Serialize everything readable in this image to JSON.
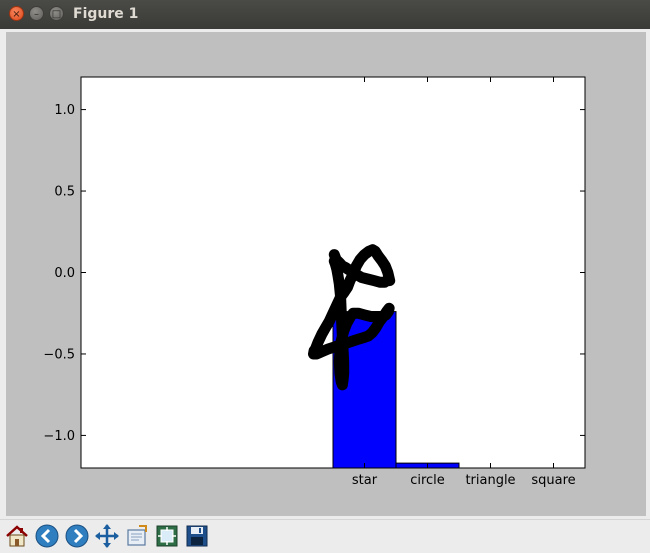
{
  "window": {
    "title": "Figure 1"
  },
  "titlebar_buttons": {
    "close_icon": "×",
    "minimize_icon": "–",
    "maximize_icon": "□"
  },
  "toolbar": {
    "items": [
      {
        "icon": "home-icon"
      },
      {
        "icon": "back-arrow-icon"
      },
      {
        "icon": "forward-arrow-icon"
      },
      {
        "icon": "pan-arrows-icon"
      },
      {
        "icon": "zoom-rect-icon"
      },
      {
        "icon": "subplots-config-icon"
      },
      {
        "icon": "save-floppy-icon"
      }
    ]
  },
  "chart_data": {
    "type": "bar",
    "categories": [
      "star",
      "circle",
      "triangle",
      "square"
    ],
    "values": [
      -0.24,
      -1.17,
      -1.2,
      -1.2
    ],
    "bar_color": "#0000ff",
    "bottom": -1.2,
    "ylim": [
      -1.2,
      1.2
    ],
    "yticks": [
      1.0,
      0.5,
      0.0,
      -0.5,
      -1.0
    ],
    "ytick_labels": [
      "1.0",
      "0.5",
      "0.0",
      "−0.5",
      "−1.0"
    ],
    "grid": false,
    "overlay_stroke": {
      "color": "#000000",
      "points": [
        [
          0.02,
          0.11
        ],
        [
          0.05,
          0.08
        ],
        [
          0.1,
          0.06
        ],
        [
          0.15,
          0.04
        ],
        [
          0.2,
          0.03
        ],
        [
          0.28,
          0.01
        ],
        [
          0.36,
          -0.01
        ],
        [
          0.45,
          -0.03
        ],
        [
          0.55,
          -0.04
        ],
        [
          0.65,
          -0.05
        ],
        [
          0.75,
          -0.06
        ],
        [
          0.82,
          -0.06
        ],
        [
          0.85,
          -0.05
        ],
        [
          0.88,
          -0.04
        ],
        [
          0.9,
          -0.05
        ],
        [
          0.87,
          0.0
        ],
        [
          0.83,
          0.04
        ],
        [
          0.78,
          0.07
        ],
        [
          0.72,
          0.1
        ],
        [
          0.67,
          0.13
        ],
        [
          0.63,
          0.14
        ],
        [
          0.57,
          0.13
        ],
        [
          0.5,
          0.11
        ],
        [
          0.43,
          0.08
        ],
        [
          0.37,
          0.04
        ],
        [
          0.32,
          -0.01
        ],
        [
          0.27,
          -0.05
        ],
        [
          0.23,
          -0.09
        ],
        [
          0.18,
          -0.12
        ],
        [
          0.12,
          -0.15
        ],
        [
          0.06,
          -0.2
        ],
        [
          0.0,
          -0.25
        ],
        [
          -0.06,
          -0.3
        ],
        [
          -0.12,
          -0.34
        ],
        [
          -0.18,
          -0.38
        ],
        [
          -0.24,
          -0.43
        ],
        [
          -0.28,
          -0.47
        ],
        [
          -0.3,
          -0.48
        ],
        [
          -0.31,
          -0.5
        ],
        [
          -0.26,
          -0.5
        ],
        [
          -0.2,
          -0.49
        ],
        [
          -0.14,
          -0.48
        ],
        [
          -0.08,
          -0.47
        ],
        [
          0.0,
          -0.46
        ],
        [
          0.08,
          -0.45
        ],
        [
          0.16,
          -0.44
        ],
        [
          0.24,
          -0.43
        ],
        [
          0.32,
          -0.42
        ],
        [
          0.4,
          -0.41
        ],
        [
          0.48,
          -0.4
        ],
        [
          0.56,
          -0.39
        ],
        [
          0.62,
          -0.37
        ],
        [
          0.68,
          -0.34
        ],
        [
          0.74,
          -0.3
        ],
        [
          0.8,
          -0.27
        ],
        [
          0.85,
          -0.24
        ],
        [
          0.89,
          -0.22
        ],
        [
          0.88,
          -0.24
        ],
        [
          0.84,
          -0.26
        ],
        [
          0.78,
          -0.27
        ],
        [
          0.7,
          -0.27
        ],
        [
          0.6,
          -0.27
        ],
        [
          0.5,
          -0.26
        ],
        [
          0.4,
          -0.25
        ],
        [
          0.32,
          -0.25
        ],
        [
          0.28,
          -0.27
        ],
        [
          0.22,
          -0.31
        ],
        [
          0.17,
          -0.36
        ],
        [
          0.13,
          -0.42
        ],
        [
          0.11,
          -0.48
        ],
        [
          0.1,
          -0.55
        ],
        [
          0.11,
          -0.62
        ],
        [
          0.13,
          -0.67
        ],
        [
          0.15,
          -0.69
        ],
        [
          0.16,
          -0.66
        ],
        [
          0.17,
          -0.62
        ],
        [
          0.17,
          -0.55
        ],
        [
          0.16,
          -0.48
        ],
        [
          0.15,
          -0.4
        ],
        [
          0.14,
          -0.32
        ],
        [
          0.13,
          -0.24
        ],
        [
          0.12,
          -0.15
        ],
        [
          0.1,
          -0.07
        ],
        [
          0.08,
          -0.02
        ],
        [
          0.06,
          0.02
        ],
        [
          0.04,
          0.05
        ],
        [
          0.02,
          0.07
        ]
      ]
    }
  }
}
